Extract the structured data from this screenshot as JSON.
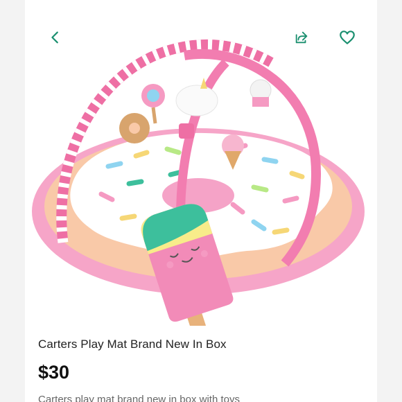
{
  "header": {
    "back_icon": "chevron-left-icon",
    "share_icon": "share-icon",
    "like_icon": "heart-outline-icon",
    "accent_color": "#1a8f6f"
  },
  "listing": {
    "title": "Carters Play Mat Brand New In Box",
    "price": "$30",
    "description": "Carters play mat brand new in box with toys"
  },
  "colors": {
    "mat_peach": "#f9c9a8",
    "mat_pink": "#f59ac2",
    "icing_white": "#ffffff",
    "arch_pink": "#ee6fa4",
    "popsicle_teal": "#3dbf9c",
    "popsicle_yellow": "#f8ec8a",
    "popsicle_pink": "#f28bb8"
  }
}
